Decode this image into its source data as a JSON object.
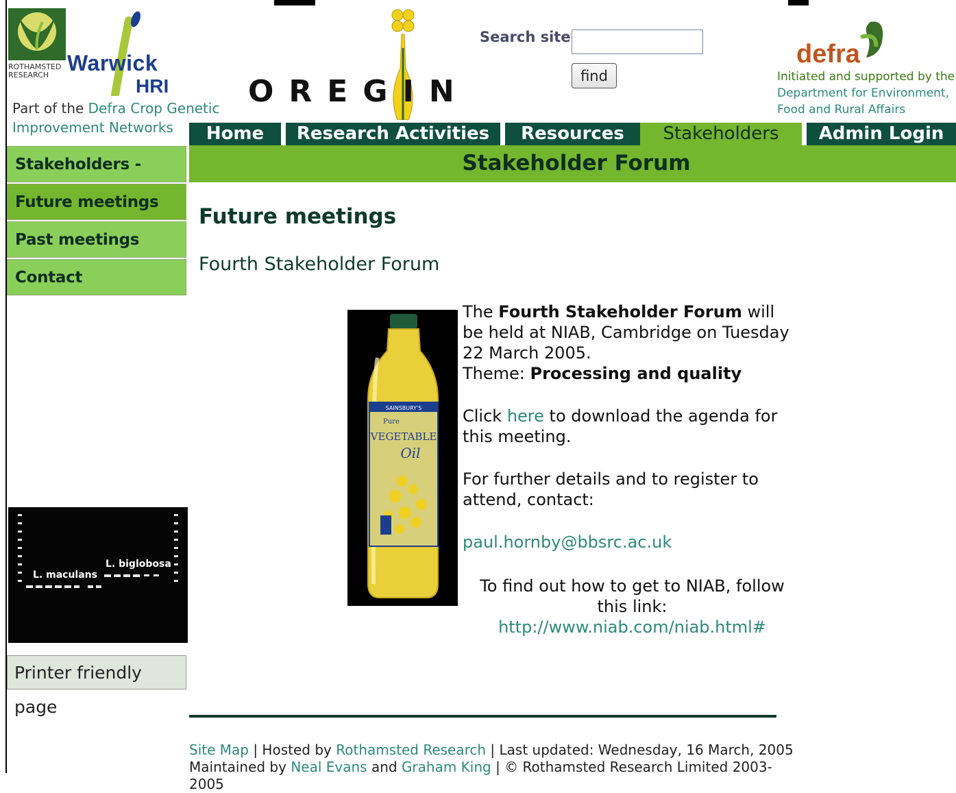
{
  "header": {
    "rothamsted_label": [
      "ROTHAMSTED",
      "RESEARCH"
    ],
    "warwick_label": "Warwick",
    "hri_label": "HRI",
    "part_of_prefix": "Part of the ",
    "part_of_link": "Defra Crop Genetic Improvement Networks",
    "oregin_label": "OREGIN",
    "search_label": "Search site:",
    "search_value": "",
    "find_label": "find",
    "defra_label": "defra",
    "defra_tagline_1": "Initiated and supported by the",
    "defra_tagline_2": "Department for Environment,",
    "defra_tagline_3": "Food and Rural Affairs"
  },
  "nav": {
    "items": [
      {
        "label": "Home"
      },
      {
        "label": "Research Activities"
      },
      {
        "label": "Resources"
      },
      {
        "label": "Stakeholders"
      },
      {
        "label": "Admin Login"
      }
    ],
    "active": "Stakeholders"
  },
  "banner": {
    "title": "Stakeholder Forum"
  },
  "sidebar": {
    "items": [
      {
        "label": "Stakeholders - Outline"
      },
      {
        "label": "Future meetings"
      },
      {
        "label": "Past meetings"
      },
      {
        "label": "Contact"
      }
    ],
    "gel_labels": {
      "left": "L. maculans",
      "right": "L. biglobosa"
    },
    "printer_label": "Printer friendly page"
  },
  "main": {
    "heading": "Future meetings",
    "subheading": "Fourth Stakeholder Forum",
    "p1_pre": "The ",
    "p1_bold": "Fourth Stakeholder Forum",
    "p1_post": " will be held at NIAB, Cambridge on Tuesday 22 March 2005.",
    "theme_label": "Theme: ",
    "theme_value": "Processing and quality",
    "p2_pre": "Click ",
    "p2_link": "here",
    "p2_post": " to download the agenda for this meeting.",
    "p3": "For further details and to register to attend, contact:",
    "email": "paul.hornby@bbsrc.ac.uk",
    "niab_pre": "To find out how to get to NIAB, follow this link: ",
    "niab_link": "http://www.niab.com/niab.html#",
    "bottle_label": [
      "SAINSBURY'S",
      "Pure",
      "VEGETABLE",
      "Oil"
    ]
  },
  "footer": {
    "site_map": "Site Map",
    "hosted_prefix": " | Hosted by ",
    "hosted_link": "Rothamsted Research",
    "updated": " | Last updated: Wednesday, 16 March, 2005",
    "maintained_prefix": "Maintained by ",
    "maintainer_1": "Neal Evans",
    "and": " and ",
    "maintainer_2": "Graham King",
    "copyright": " | © Rothamsted Research Limited 2003-2005"
  },
  "colors": {
    "nav_dark": "#0e4f3e",
    "nav_active": "#74b62d",
    "sidebar_light": "#8bcf5b",
    "link": "#2c8a7a",
    "defra_orange": "#c0561e"
  }
}
